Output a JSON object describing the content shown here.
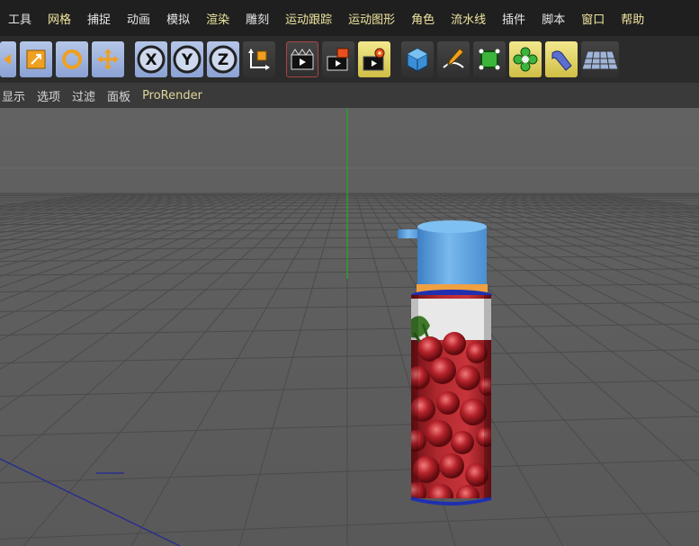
{
  "menu": [
    "工具",
    "网格",
    "捕捉",
    "动画",
    "模拟",
    "渲染",
    "雕刻",
    "运动跟踪",
    "运动图形",
    "角色",
    "流水线",
    "插件",
    "脚本",
    "窗口",
    "帮助"
  ],
  "toolbar_icons": [
    "move-arrow-icon",
    "scale-icon",
    "rotate-icon",
    "move-icon",
    "x-axis-lock-icon",
    "y-axis-lock-icon",
    "z-axis-lock-icon",
    "coordinate-system-icon",
    "render-view-icon",
    "render-to-picture-viewer-icon",
    "render-settings-icon",
    "cube-icon",
    "pen-spline-icon",
    "subdivision-surface-icon",
    "cloner-icon",
    "bend-deformer-icon",
    "floor-icon"
  ],
  "axis_labels": {
    "x": "X",
    "y": "Y",
    "z": "Z"
  },
  "viewport_menu": [
    "显示",
    "选项",
    "过滤",
    "面板",
    "ProRender"
  ],
  "colors": {
    "menubar_bg": "#1f1f1f",
    "toolbar_bg": "#2b2b2b",
    "viewport_bg": "#5c5c5c",
    "cap_blue": "#6aaee6",
    "ring_orange": "#f0a040"
  }
}
